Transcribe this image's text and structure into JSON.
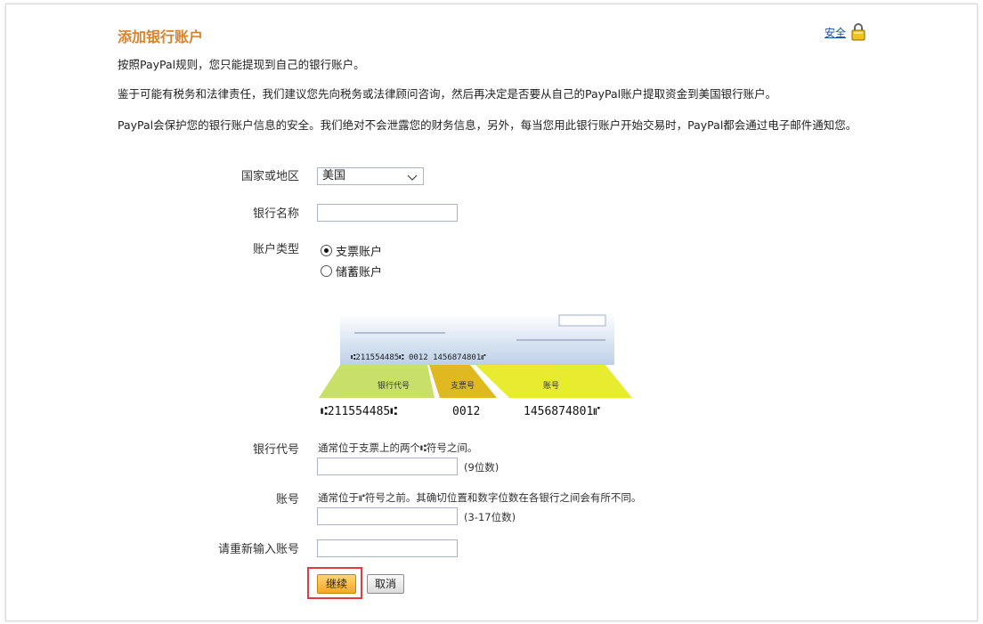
{
  "page": {
    "title": "添加银行账户",
    "security_link": "安全",
    "intro": [
      "按照PayPal规则，您只能提现到自己的银行账户。",
      "鉴于可能有税务和法律责任，我们建议您先向税务或法律顾问咨询，然后再决定是否要从自己的PayPal账户提取资金到美国银行账户。",
      "PayPal会保护您的银行账户信息的安全。我们绝对不会泄露您的财务信息，另外，每当您用此银行账户开始交易时，PayPal都会通过电子邮件通知您。"
    ]
  },
  "form": {
    "country_label": "国家或地区",
    "country_value": "美国",
    "bank_name_label": "银行名称",
    "bank_name_value": "",
    "account_type_label": "账户类型",
    "account_types": [
      {
        "label": "支票账户",
        "selected": true
      },
      {
        "label": "储蓄账户",
        "selected": false
      }
    ],
    "routing_label": "银行代号",
    "routing_hint": "通常位于支票上的两个⑆符号之间。",
    "routing_sub": "(9位数)",
    "account_label": "账号",
    "account_hint": "通常位于⑈符号之前。其确切位置和数字位数在各银行之间会有所不同。",
    "account_sub": "(3-17位数)",
    "reenter_label": "请重新输入账号"
  },
  "check_image": {
    "micr_line_top": "⑆211554485⑆  0012  1456874801⑈",
    "labels": [
      "银行代号",
      "支票号",
      "账号"
    ],
    "routing_number": "⑆211554485⑆",
    "check_number": "0012",
    "account_number": "1456874801⑈"
  },
  "buttons": {
    "continue": "继续",
    "cancel": "取消"
  },
  "colors": {
    "title": "#d9822b",
    "link": "#1a4fa0",
    "highlight_border": "#e03c3c",
    "check_routing": "#c8e06a",
    "check_checknum": "#e0b820",
    "check_account": "#e8ec30"
  }
}
